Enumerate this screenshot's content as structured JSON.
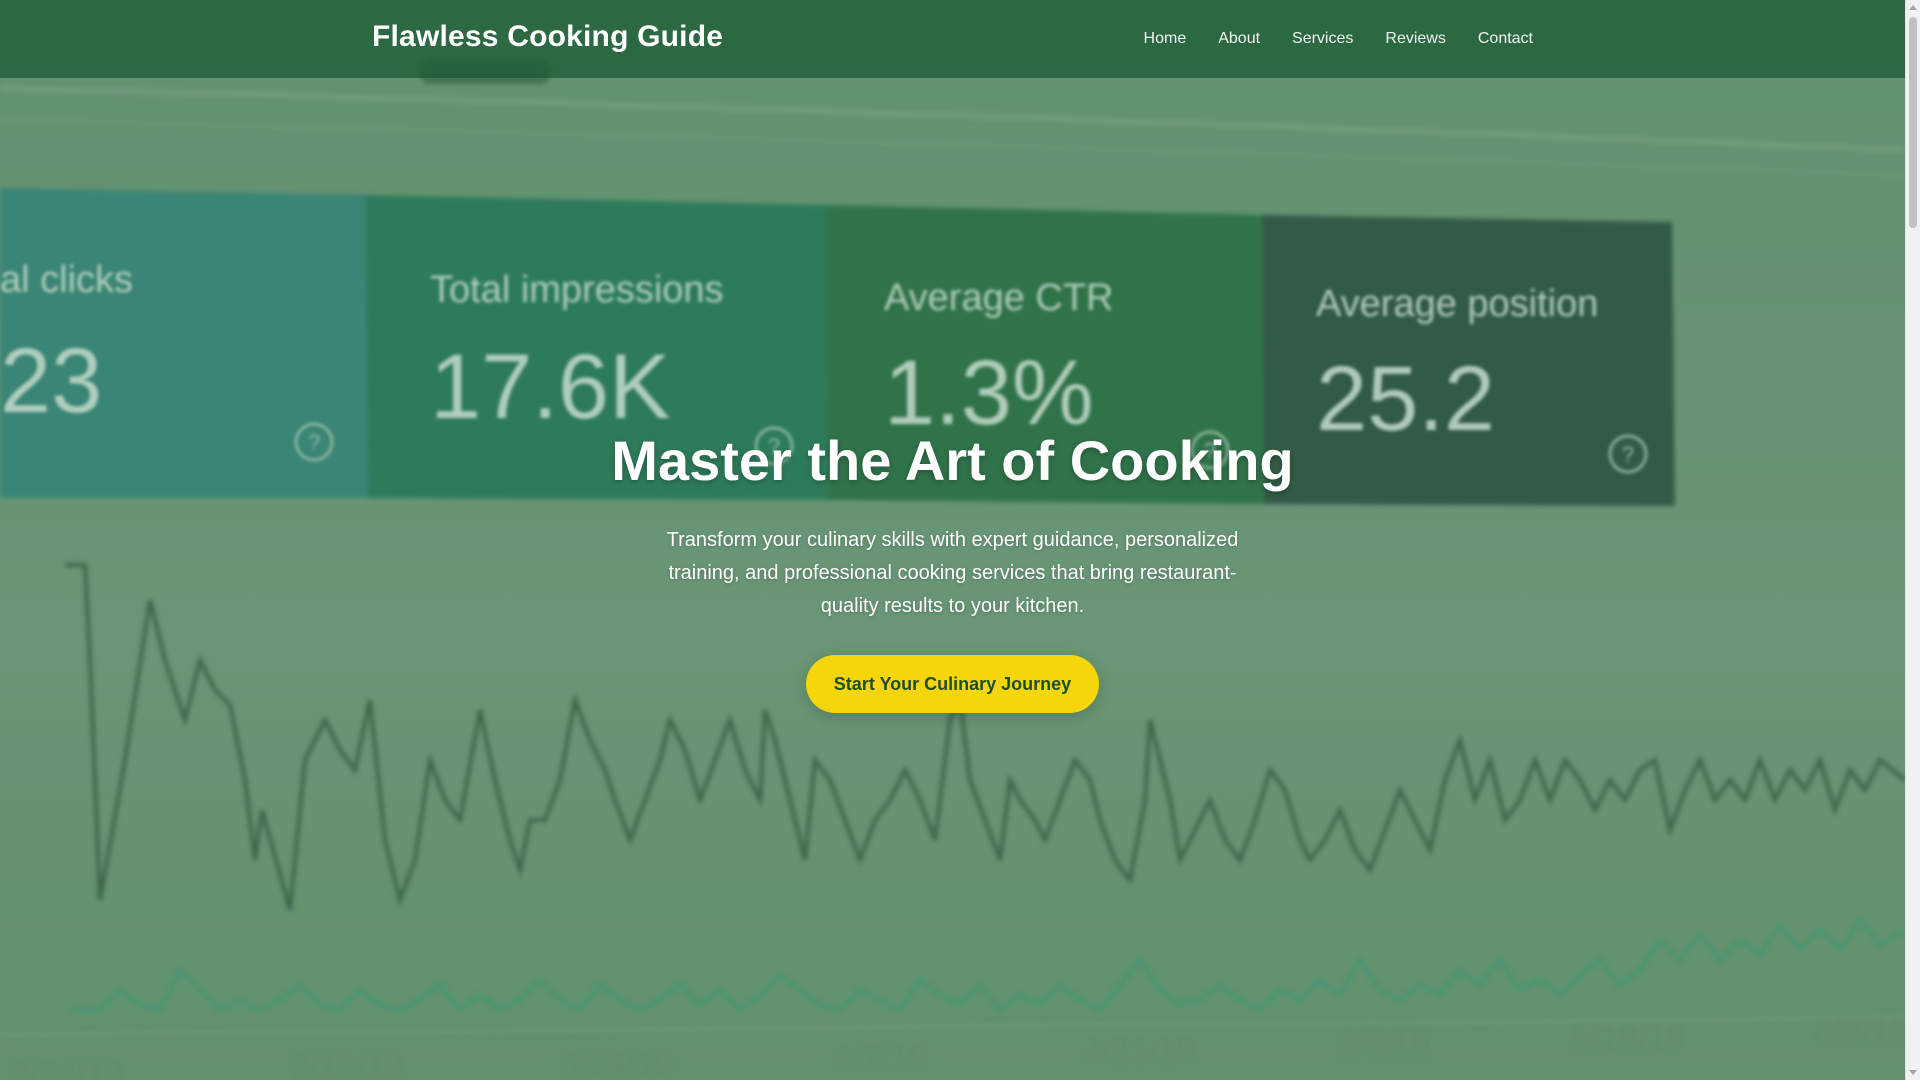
{
  "site": {
    "title": "Flawless Cooking Guide"
  },
  "nav": {
    "items": [
      "Home",
      "About",
      "Services",
      "Reviews",
      "Contact"
    ]
  },
  "hero": {
    "heading": "Master the Art of Cooking",
    "description": "Transform your culinary skills with expert guidance, personalized training, and professional cooking services that bring restaurant-quality results to your kitchen.",
    "cta_label": "Start Your Culinary Journey"
  },
  "background": {
    "metrics": [
      {
        "label": "al clicks",
        "value": "23"
      },
      {
        "label": "Total impressions",
        "value": "17.6K"
      },
      {
        "label": "Average CTR",
        "value": "1.3%"
      },
      {
        "label": "Average position",
        "value": "25.2"
      }
    ],
    "dates": [
      "2/24/19",
      "3/10/19",
      "3/24/19",
      "4/7/19",
      "4/21/19",
      "5/5/19",
      "5/19/19",
      "6/2/19"
    ],
    "help_icon": "?"
  },
  "colors": {
    "header_bg": "#1e5c36",
    "cta_bg": "#f5d60b",
    "cta_text": "#1e4d2b",
    "text": "#ffffff"
  }
}
